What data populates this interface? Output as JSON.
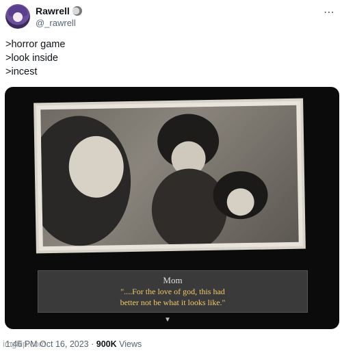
{
  "author": {
    "display_name": "Rawrell",
    "handle": "@_rawrell"
  },
  "tweet": {
    "lines": [
      ">horror game",
      ">look inside",
      ">incest"
    ]
  },
  "media": {
    "speaker": "Mom",
    "dialog_line1": "\"....For the love of god, this had",
    "dialog_line2": "better not be what it looks like.\""
  },
  "meta": {
    "time": "1:46 PM",
    "separator": "·",
    "date": "Oct 16, 2023",
    "views_count": "900K",
    "views_label": "Views"
  },
  "watermark": "imgflip.com"
}
